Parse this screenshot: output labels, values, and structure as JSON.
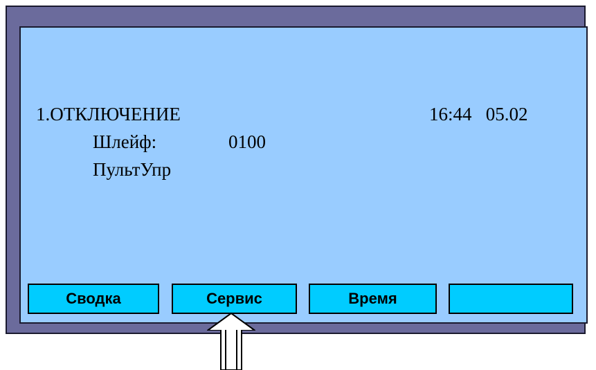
{
  "screen": {
    "event_title": "1.ОТКЛЮЧЕНИЕ",
    "datetime": "16:44   05.02",
    "zone_label": "Шлейф:",
    "zone_value": "0100",
    "source": "ПультУпр"
  },
  "softkeys": [
    {
      "label": "Сводка"
    },
    {
      "label": "Сервис"
    },
    {
      "label": "Время"
    },
    {
      "label": ""
    }
  ],
  "colors": {
    "frame": "#6b6b9c",
    "screen": "#99ccff",
    "softkey": "#00ccff"
  },
  "pointer": {
    "icon": "up-arrow-icon",
    "target": "Сервис"
  }
}
